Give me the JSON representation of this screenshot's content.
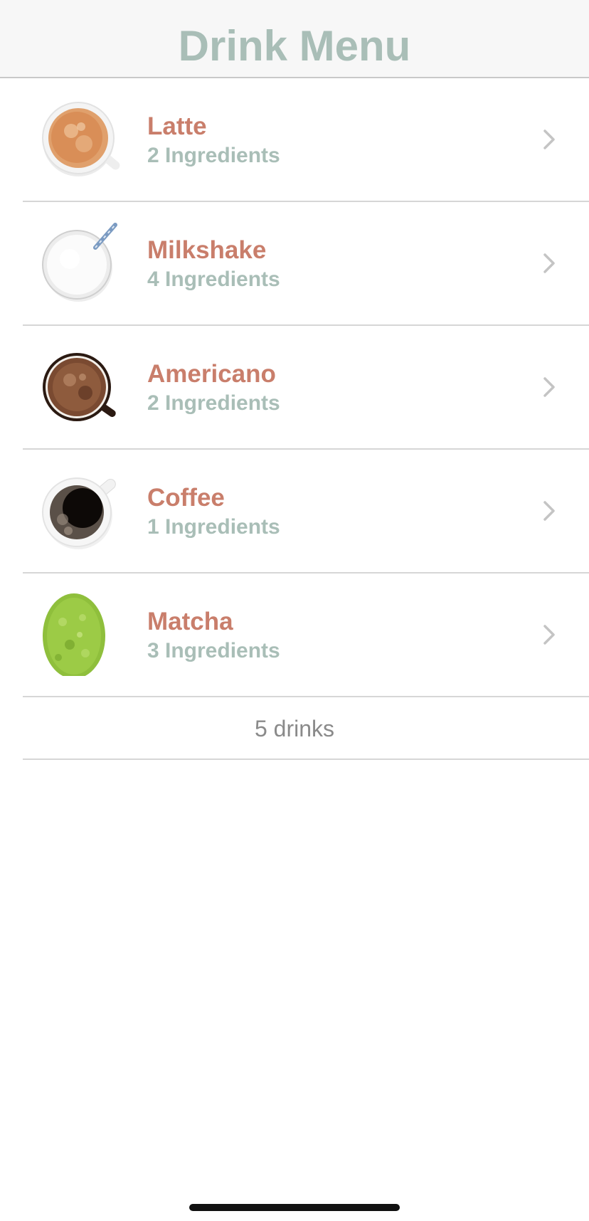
{
  "nav": {
    "title": "Drink Menu"
  },
  "drinks": [
    {
      "name": "Latte",
      "ingredients": "2 Ingredients",
      "icon": "latte-cup-icon"
    },
    {
      "name": "Milkshake",
      "ingredients": "4 Ingredients",
      "icon": "milkshake-glass-icon"
    },
    {
      "name": "Americano",
      "ingredients": "2 Ingredients",
      "icon": "americano-cup-icon"
    },
    {
      "name": "Coffee",
      "ingredients": "1 Ingredients",
      "icon": "coffee-cup-icon"
    },
    {
      "name": "Matcha",
      "ingredients": "3 Ingredients",
      "icon": "matcha-powder-icon"
    }
  ],
  "footer": {
    "count_text": "5 drinks"
  },
  "colors": {
    "title": "#a9beb7",
    "drink_name": "#c97e6b",
    "ingredients": "#a9beb7",
    "chevron": "#c4c4c4"
  }
}
